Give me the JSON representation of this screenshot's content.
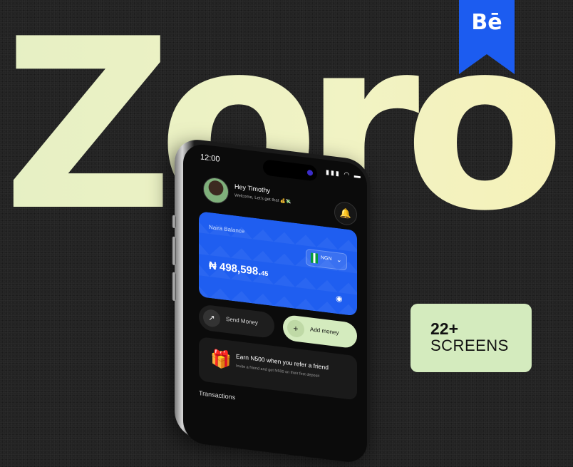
{
  "hero": {
    "title": "Zoro"
  },
  "badge": {
    "logo_text": "Bē",
    "color": "#1c5cf0"
  },
  "screens": {
    "count": "22+",
    "label": "SCREENS"
  },
  "phone": {
    "status": {
      "time": "12:00",
      "icons": "signal-icon wifi-icon battery-icon"
    },
    "greeting": {
      "name": "Hey Timothy",
      "welcome": "Welcome, Let's get that 💰💸"
    },
    "balance": {
      "label": "Naira Balance",
      "currency": "NGN",
      "amount_main": "₦ 498,598.",
      "amount_cents": "45"
    },
    "actions": {
      "send_label": "Send Money",
      "add_label": "Add money"
    },
    "refer": {
      "title": "Earn N500 when you refer a friend",
      "subtitle": "Invite a friend and get N500 on their first deposit"
    },
    "transactions_label": "Transactions"
  },
  "colors": {
    "accent_green": "#d4ebbe",
    "card_blue": "#1f5ef0",
    "hero_yellow": "#edf2c6"
  }
}
